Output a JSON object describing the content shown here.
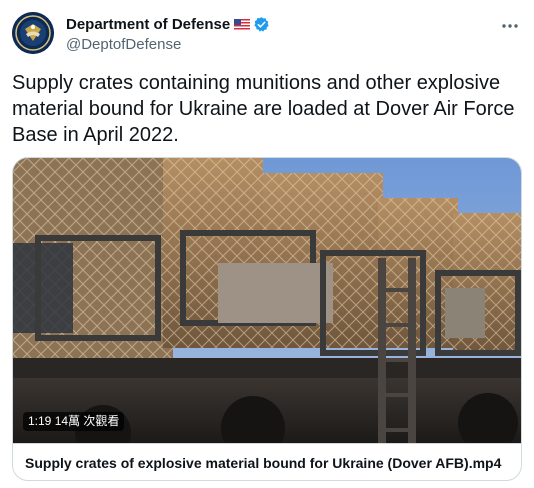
{
  "author": {
    "display_name": "Department of Defense",
    "handle": "@DeptofDefense",
    "avatar_icon": "department-of-defense-seal",
    "flag_icon": "us-flag",
    "verified_icon": "verified-badge",
    "verified_color": "#1d9bf0"
  },
  "tweet": {
    "text": "Supply crates containing munitions and other explosive material bound for Ukraine are loaded at Dover Air Force Base in April 2022."
  },
  "media": {
    "duration": "1:19",
    "views": "14萬 次觀看",
    "caption": "Supply crates of explosive material bound for Ukraine (Dover AFB).mp4"
  },
  "menu": {
    "icon": "more-horizontal-icon"
  }
}
